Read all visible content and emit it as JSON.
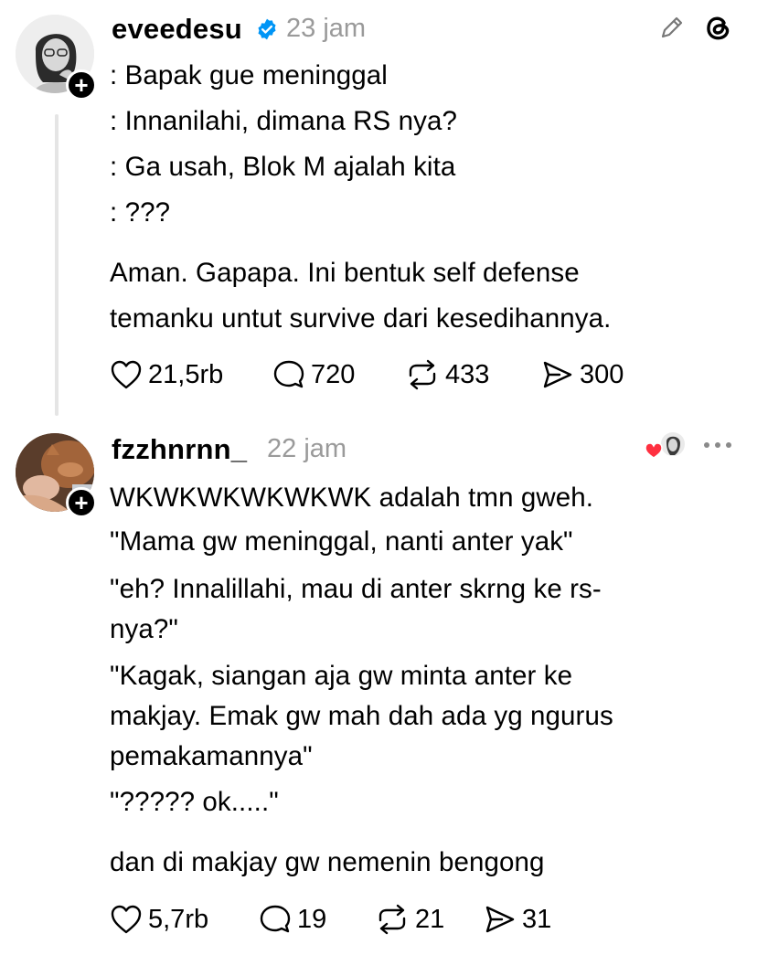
{
  "posts": [
    {
      "username": "eveedesu",
      "verified": true,
      "time": "23 jam",
      "lines": [
        ": Bapak gue meninggal",
        ": Innanilahi, dimana RS nya?",
        ": Ga usah, Blok M ajalah kita",
        ": ???",
        "Aman. Gapapa. Ini bentuk self defense",
        "temanku untut survive dari kesedihannya."
      ],
      "stats": {
        "likes": "21,5rb",
        "replies": "720",
        "reposts": "433",
        "shares": "300"
      },
      "icons": [
        "edit-pencil-icon",
        "threads-logo-icon"
      ]
    },
    {
      "username": "fzzhnrnn_",
      "verified": false,
      "time": "22 jam",
      "lines": [
        "WKWKWKWKWKWK adalah tmn gweh.",
        "\"Mama gw meninggal, nanti anter yak\"",
        "\"eh? Innalillahi, mau di anter skrng ke rs-",
        "nya?\"",
        "\"Kagak, siangan aja gw minta anter ke",
        "makjay. Emak gw mah dah ada yg ngurus",
        "pemakamannya\"",
        "\"????? ok.....\"",
        "dan di makjay gw nemenin bengong"
      ],
      "stats": {
        "likes": "5,7rb",
        "replies": "19",
        "reposts": "21",
        "shares": "31"
      },
      "icons": [
        "liked-by-author-icon",
        "more-options-icon"
      ]
    }
  ],
  "colors": {
    "text": "#000000",
    "muted": "#9a9a9a",
    "verified": "#0095f6",
    "heart": "#ff3040",
    "thread_line": "#e5e5e5"
  }
}
